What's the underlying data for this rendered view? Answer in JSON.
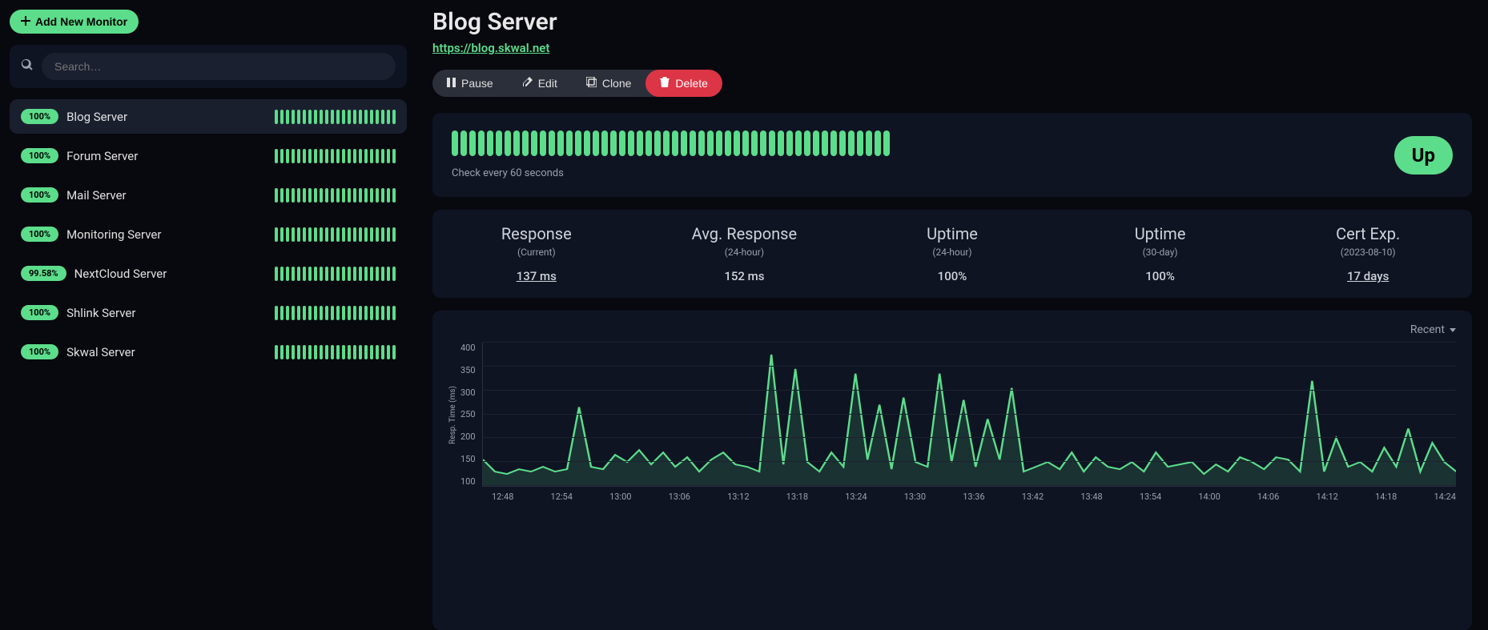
{
  "sidebar": {
    "add_button": "Add New Monitor",
    "search_placeholder": "Search…",
    "monitors": [
      {
        "pct": "100%",
        "name": "Blog Server",
        "selected": true
      },
      {
        "pct": "100%",
        "name": "Forum Server",
        "selected": false
      },
      {
        "pct": "100%",
        "name": "Mail Server",
        "selected": false
      },
      {
        "pct": "100%",
        "name": "Monitoring Server",
        "selected": false
      },
      {
        "pct": "99.58%",
        "name": "NextCloud Server",
        "selected": false
      },
      {
        "pct": "100%",
        "name": "Shlink Server",
        "selected": false
      },
      {
        "pct": "100%",
        "name": "Skwal Server",
        "selected": false
      }
    ]
  },
  "main": {
    "title": "Blog Server",
    "url": "https://blog.skwal.net",
    "actions": {
      "pause": "Pause",
      "edit": "Edit",
      "clone": "Clone",
      "delete": "Delete"
    },
    "status": {
      "check_text": "Check every 60 seconds",
      "up_label": "Up",
      "bar_count": 50
    },
    "stats": [
      {
        "title": "Response",
        "sub": "(Current)",
        "val": "137 ms",
        "link": true
      },
      {
        "title": "Avg. Response",
        "sub": "(24-hour)",
        "val": "152 ms",
        "link": false
      },
      {
        "title": "Uptime",
        "sub": "(24-hour)",
        "val": "100%",
        "link": false
      },
      {
        "title": "Uptime",
        "sub": "(30-day)",
        "val": "100%",
        "link": false
      },
      {
        "title": "Cert Exp.",
        "sub": "(2023-08-10)",
        "val": "17 days",
        "link": true
      }
    ],
    "chart_selector": "Recent"
  },
  "chart_data": {
    "type": "line",
    "title": "",
    "xlabel": "",
    "ylabel": "Resp. Time (ms)",
    "ylim": [
      100,
      400
    ],
    "y_ticks": [
      100,
      150,
      200,
      250,
      300,
      350,
      400
    ],
    "categories": [
      "12:48",
      "12:54",
      "13:00",
      "13:06",
      "13:12",
      "13:18",
      "13:24",
      "13:30",
      "13:36",
      "13:42",
      "13:48",
      "13:54",
      "14:00",
      "14:06",
      "14:12",
      "14:18",
      "14:24"
    ],
    "series": [
      {
        "name": "Resp. Time (ms)",
        "values": [
          155,
          130,
          125,
          135,
          130,
          140,
          130,
          135,
          265,
          140,
          135,
          165,
          150,
          175,
          145,
          170,
          140,
          160,
          130,
          155,
          170,
          145,
          140,
          130,
          375,
          145,
          345,
          150,
          130,
          170,
          140,
          335,
          155,
          270,
          135,
          285,
          150,
          140,
          335,
          150,
          280,
          140,
          240,
          155,
          305,
          130,
          140,
          150,
          135,
          170,
          130,
          160,
          140,
          135,
          150,
          130,
          170,
          140,
          145,
          150,
          125,
          145,
          130,
          160,
          150,
          135,
          160,
          155,
          130,
          320,
          130,
          200,
          140,
          150,
          130,
          180,
          140,
          220,
          130,
          190,
          150,
          130
        ]
      }
    ]
  }
}
